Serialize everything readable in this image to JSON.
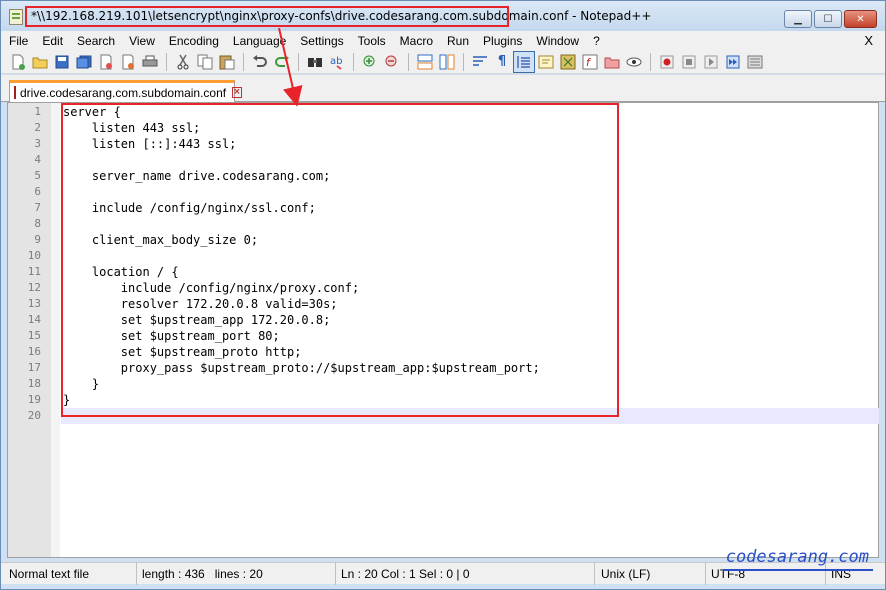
{
  "window": {
    "title_path": "*\\\\192.168.219.101\\letsencrypt\\nginx\\proxy-confs\\drive.codesarang.com.subdomain.conf",
    "title_app": " - Notepad++",
    "buttons": {
      "minimize": "▁",
      "maximize": "☐",
      "close": "✕"
    }
  },
  "menu": {
    "items": [
      "File",
      "Edit",
      "Search",
      "View",
      "Encoding",
      "Language",
      "Settings",
      "Tools",
      "Macro",
      "Run",
      "Plugins",
      "Window",
      "?"
    ],
    "close_doc": "X"
  },
  "toolbar": {
    "icons": [
      "new-file-icon",
      "open-file-icon",
      "save-icon",
      "save-all-icon",
      "close-icon",
      "close-all-icon",
      "print-icon",
      "cut-icon",
      "copy-icon",
      "paste-icon",
      "undo-icon",
      "redo-icon",
      "find-icon",
      "replace-icon",
      "zoom-in-icon",
      "zoom-out-icon",
      "sync-vertical-icon",
      "sync-horizontal-icon",
      "word-wrap-icon",
      "show-all-chars-icon",
      "indent-guide-icon",
      "user-defined-lang-icon",
      "document-map-icon",
      "function-list-icon",
      "folder-workspace-icon",
      "monitoring-icon",
      "record-macro-icon",
      "stop-record-icon",
      "play-macro-icon",
      "run-macro-multiple-icon",
      "save-macro-icon"
    ]
  },
  "tab": {
    "label": "drive.codesarang.com.subdomain.conf",
    "close": "×"
  },
  "editor": {
    "lines": [
      "server {",
      "    listen 443 ssl;",
      "    listen [::]:443 ssl;",
      "",
      "    server_name drive.codesarang.com;",
      "",
      "    include /config/nginx/ssl.conf;",
      "",
      "    client_max_body_size 0;",
      "",
      "    location / {",
      "        include /config/nginx/proxy.conf;",
      "        resolver 172.20.0.8 valid=30s;",
      "        set $upstream_app 172.20.0.8;",
      "        set $upstream_port 80;",
      "        set $upstream_proto http;",
      "        proxy_pass $upstream_proto://$upstream_app:$upstream_port;",
      "    }",
      "}",
      ""
    ],
    "line_numbers": [
      "1",
      "2",
      "3",
      "4",
      "5",
      "6",
      "7",
      "8",
      "9",
      "10",
      "11",
      "12",
      "13",
      "14",
      "15",
      "16",
      "17",
      "18",
      "19",
      "20"
    ]
  },
  "status": {
    "lang": "Normal text file",
    "length": "length : 436",
    "lines": "lines : 20",
    "position": "Ln : 20   Col : 1   Sel : 0 | 0",
    "eol": "Unix (LF)",
    "encoding": "UTF-8",
    "mode": "INS"
  },
  "watermark": "codesarang.com",
  "colors": {
    "highlight": "#e8232a",
    "tab_accent": "#fa9e34",
    "watermark": "#2a4fc8"
  }
}
